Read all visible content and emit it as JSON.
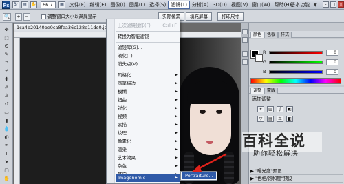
{
  "menubar": {
    "app_logo": "Ps",
    "zoom": "66.7",
    "items": [
      "文件(F)",
      "编辑(E)",
      "图像(I)",
      "图层(L)",
      "选择(S)",
      "滤镜(T)",
      "分析(A)",
      "3D(D)",
      "视图(V)",
      "窗口(W)",
      "帮助(H)"
    ],
    "active_index": 5,
    "workspace": "基本功能",
    "workspace_arrow": "▼",
    "window_buttons": [
      "-",
      "□",
      "×"
    ]
  },
  "options": {
    "resize_windows_label": "调整窗口大小以满屏显示",
    "actual_pixels": "实际像素",
    "fill_screen": "填充屏幕",
    "print_size": "打印尺寸"
  },
  "document": {
    "tab_title": "1ca4b20140be0ca8fea36c128e11de0.jpg @ 66..."
  },
  "filter_menu": {
    "last_filter": "上次滤镜操作(F)",
    "last_filter_shortcut": "Ctrl+F",
    "convert_smart": "转换为智能滤镜",
    "filter_gallery": "滤镜库(G)...",
    "liquify": "液化(L)...",
    "vanishing_point": "消失点(V)...",
    "submenus": [
      "风格化",
      "画笔描边",
      "模糊",
      "扭曲",
      "锐化",
      "视频",
      "素描",
      "纹理",
      "像素化",
      "渲染",
      "艺术效果",
      "杂色",
      "其它"
    ],
    "imagenomic": "Imagenomic",
    "submenu_arrow": "▶"
  },
  "submenu": {
    "item": "Portraiture..."
  },
  "panels": {
    "color_tab": "颜色",
    "swatches_tab": "色板",
    "styles_tab": "样式",
    "r_label": "R",
    "g_label": "G",
    "b_label": "B",
    "r_value": "0",
    "g_value": "0",
    "b_value": "0",
    "adjust_tab": "调整",
    "masks_tab": "蒙版",
    "adjust_title": "添加调整",
    "presets": [
      "▶ \"曝光度\"预设",
      "▶ \"色相/饱和度\"预设"
    ]
  },
  "watermark": {
    "title": "百科全说",
    "subtitle": "助你轻松解决"
  },
  "colors": {
    "menu_highlight": "#2f5aa8",
    "annotation_red": "#e0221b"
  }
}
